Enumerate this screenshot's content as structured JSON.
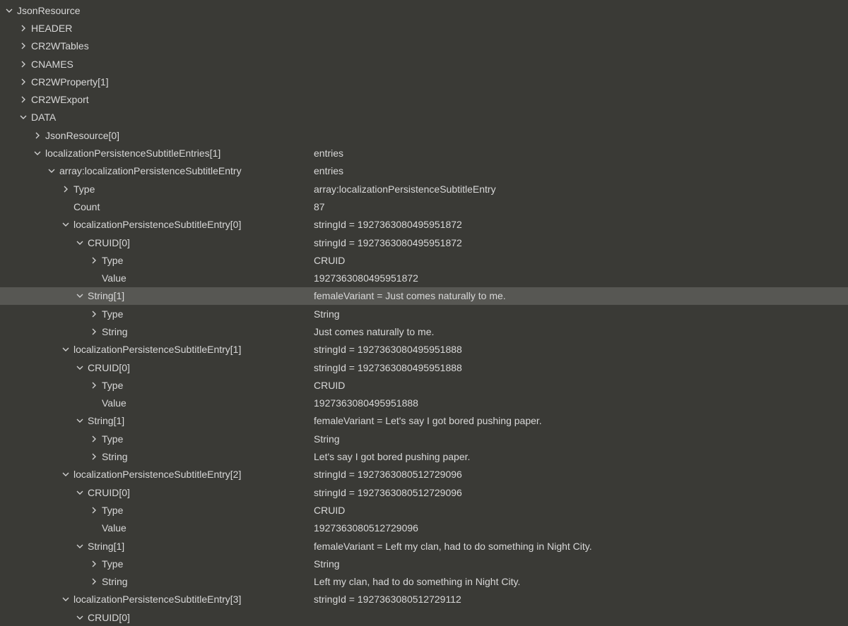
{
  "root": "JsonResource",
  "n1": "HEADER",
  "n2": "CR2WTables",
  "n3": "CNAMES",
  "n4": "CR2WProperty[1]",
  "n5": "CR2WExport",
  "n6": "DATA",
  "n7": "JsonResource[0]",
  "n8": {
    "k": "localizationPersistenceSubtitleEntries[1]",
    "v": "entries"
  },
  "n9": {
    "k": "array:localizationPersistenceSubtitleEntry",
    "v": "entries"
  },
  "n10": {
    "k": "Type",
    "v": "array:localizationPersistenceSubtitleEntry"
  },
  "n11": {
    "k": "Count",
    "v": "87"
  },
  "e0": {
    "k": "localizationPersistenceSubtitleEntry[0]",
    "v": "stringId = 1927363080495951872"
  },
  "e0_cruid": {
    "k": "CRUID[0]",
    "v": "stringId   =   1927363080495951872"
  },
  "e0_cruid_type": {
    "k": "Type",
    "v": "CRUID"
  },
  "e0_cruid_val": {
    "k": "Value",
    "v": "1927363080495951872"
  },
  "e0_str": {
    "k": "String[1]",
    "v": "femaleVariant   =   Just comes naturally to me."
  },
  "e0_str_type": {
    "k": "Type",
    "v": "String"
  },
  "e0_str_val": {
    "k": "String",
    "v": "Just comes naturally to me."
  },
  "e1": {
    "k": "localizationPersistenceSubtitleEntry[1]",
    "v": "stringId = 1927363080495951888"
  },
  "e1_cruid": {
    "k": "CRUID[0]",
    "v": "stringId   =   1927363080495951888"
  },
  "e1_cruid_type": {
    "k": "Type",
    "v": "CRUID"
  },
  "e1_cruid_val": {
    "k": "Value",
    "v": "1927363080495951888"
  },
  "e1_str": {
    "k": "String[1]",
    "v": "femaleVariant   =   Let's say I got bored pushing paper."
  },
  "e1_str_type": {
    "k": "Type",
    "v": "String"
  },
  "e1_str_val": {
    "k": "String",
    "v": "Let's say I got bored pushing paper."
  },
  "e2": {
    "k": "localizationPersistenceSubtitleEntry[2]",
    "v": "stringId = 1927363080512729096"
  },
  "e2_cruid": {
    "k": "CRUID[0]",
    "v": "stringId   =   1927363080512729096"
  },
  "e2_cruid_type": {
    "k": "Type",
    "v": "CRUID"
  },
  "e2_cruid_val": {
    "k": "Value",
    "v": "1927363080512729096"
  },
  "e2_str": {
    "k": "String[1]",
    "v": "femaleVariant   =   Left my clan, had to do something in Night City."
  },
  "e2_str_type": {
    "k": "Type",
    "v": "String"
  },
  "e2_str_val": {
    "k": "String",
    "v": "Left my clan, had to do something in Night City."
  },
  "e3": {
    "k": "localizationPersistenceSubtitleEntry[3]",
    "v": "stringId = 1927363080512729112"
  },
  "e3_cruid": {
    "k": "CRUID[0]",
    "v": ""
  }
}
